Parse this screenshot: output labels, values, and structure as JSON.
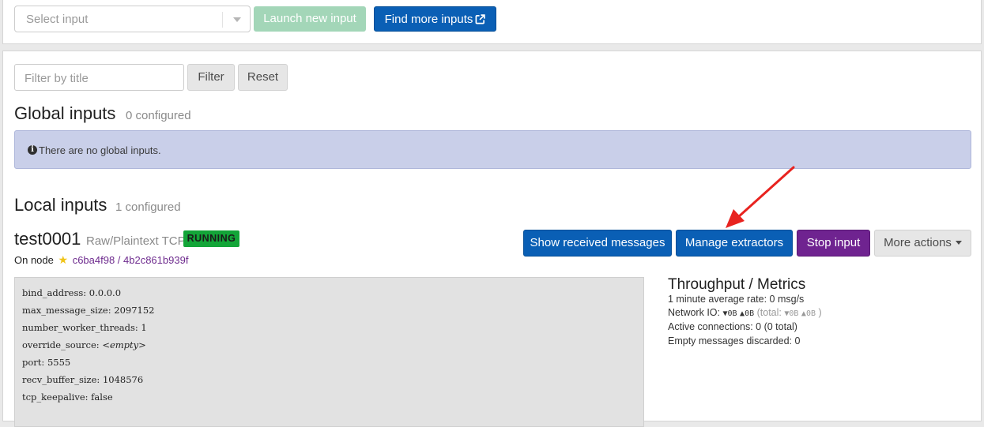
{
  "toolbar": {
    "select_placeholder": "Select input",
    "launch_label": "Launch new input",
    "find_label": "Find more inputs"
  },
  "filter": {
    "placeholder": "Filter by title",
    "filter_label": "Filter",
    "reset_label": "Reset"
  },
  "global_inputs": {
    "title": "Global inputs",
    "count": "0 configured",
    "empty_message": "There are no global inputs."
  },
  "local_inputs": {
    "title": "Local inputs",
    "count": "1 configured"
  },
  "input": {
    "name": "test0001",
    "type": "Raw/Plaintext TCP",
    "status": "RUNNING",
    "node_prefix": "On node",
    "node_id": "c6ba4f98 / 4b2c861b939f",
    "buttons": {
      "show_messages": "Show received messages",
      "manage_extractors": "Manage extractors",
      "stop_input": "Stop input",
      "more_actions": "More actions"
    },
    "config": [
      {
        "key": "bind_address:",
        "value": "0.0.0.0"
      },
      {
        "key": "max_message_size:",
        "value": "2097152"
      },
      {
        "key": "number_worker_threads:",
        "value": "1"
      },
      {
        "key": "override_source:",
        "value": "<empty>"
      },
      {
        "key": "port:",
        "value": "5555"
      },
      {
        "key": "recv_buffer_size:",
        "value": "1048576"
      },
      {
        "key": "tcp_keepalive:",
        "value": "false"
      }
    ]
  },
  "metrics": {
    "title": "Throughput / Metrics",
    "avg_rate": "1 minute average rate: 0 msg/s",
    "network_io_label": "Network IO:",
    "net_in": "0B",
    "net_out": "0B",
    "total_label": "(total:",
    "total_in": "0B",
    "total_out": "0B",
    "total_close": ")",
    "active_connections": "Active connections: 0 (0 total)",
    "empty_discarded": "Empty messages discarded: 0"
  },
  "colors": {
    "primary": "#0a5fb5",
    "success": "#13a538",
    "stop": "#6f2390",
    "annotation_arrow": "#e8231f"
  }
}
